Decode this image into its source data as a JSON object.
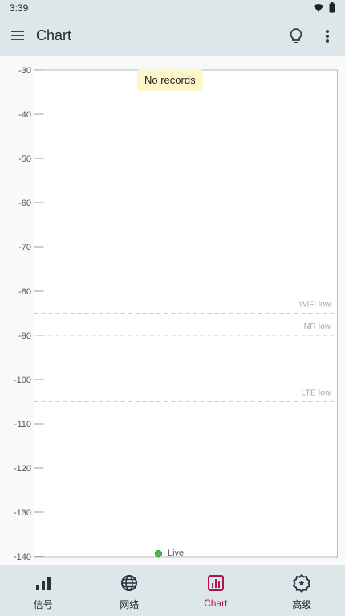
{
  "status_bar": {
    "time": "3:39"
  },
  "app_bar": {
    "title": "Chart"
  },
  "chart": {
    "tooltip": "No records",
    "live_label": "Live",
    "threshold_labels": {
      "wifi": "WiFi low",
      "nr": "NR low",
      "lte": "LTE low"
    }
  },
  "chart_data": {
    "type": "line",
    "ylim": [
      -140,
      -30
    ],
    "y_ticks": [
      -30,
      -40,
      -50,
      -60,
      -70,
      -80,
      -90,
      -100,
      -110,
      -120,
      -130,
      -140
    ],
    "series": [],
    "thresholds": [
      {
        "name": "WiFi low",
        "value": -85
      },
      {
        "name": "NR low",
        "value": -90
      },
      {
        "name": "LTE low",
        "value": -105
      }
    ],
    "grid": false
  },
  "bottom_nav": {
    "items": [
      {
        "label": "信号",
        "icon": "signal-bars-icon"
      },
      {
        "label": "网络",
        "icon": "globe-icon"
      },
      {
        "label": "Chart",
        "icon": "bar-chart-icon",
        "active": true
      },
      {
        "label": "高级",
        "icon": "settings-badge-icon"
      }
    ]
  },
  "colors": {
    "accent": "#b0164d",
    "bar_bg": "#dde7ea",
    "live": "#3bc33b"
  }
}
